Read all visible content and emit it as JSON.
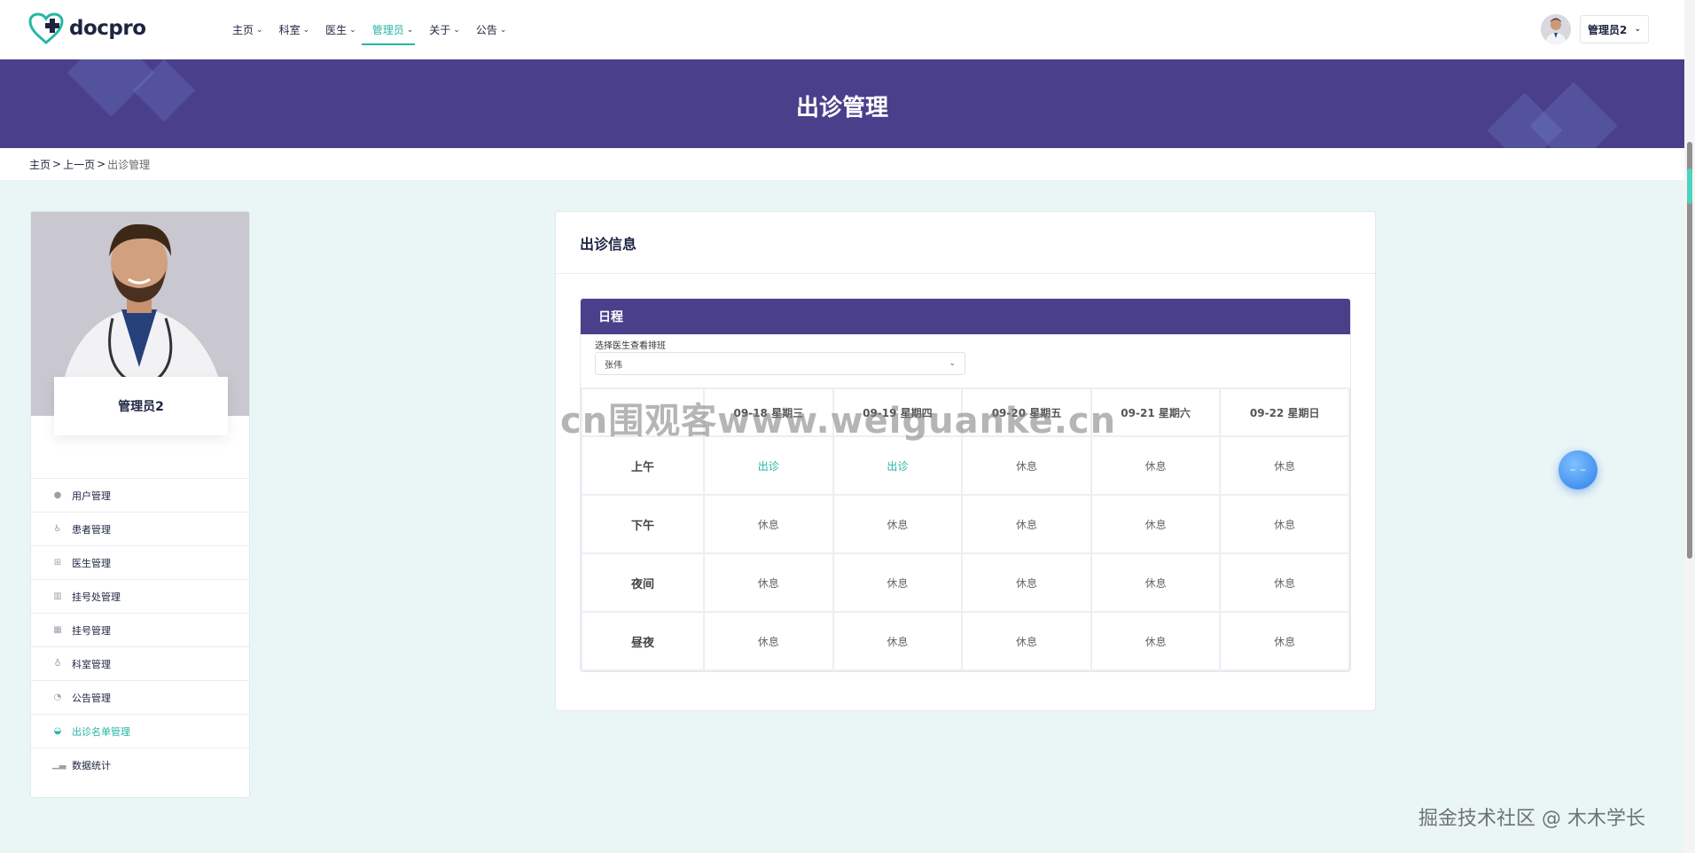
{
  "brand": {
    "name": "docpro",
    "accent": "#26b5a5",
    "banner_color": "#4a3f8b"
  },
  "nav": [
    {
      "label": "主页",
      "active": false
    },
    {
      "label": "科室",
      "active": false
    },
    {
      "label": "医生",
      "active": false
    },
    {
      "label": "管理员",
      "active": true
    },
    {
      "label": "关于",
      "active": false
    },
    {
      "label": "公告",
      "active": false
    }
  ],
  "user": {
    "name": "管理员2"
  },
  "banner": {
    "title": "出诊管理"
  },
  "breadcrumb": {
    "home": "主页",
    "back": "上一页",
    "current": "出诊管理",
    "sep": ">"
  },
  "profile": {
    "name": "管理员2"
  },
  "sidebar": {
    "items": [
      {
        "label": "用户管理",
        "icon": "user-icon",
        "active": false
      },
      {
        "label": "患者管理",
        "icon": "wheelchair-icon",
        "active": false
      },
      {
        "label": "医生管理",
        "icon": "medical-plus-icon",
        "active": false
      },
      {
        "label": "挂号处管理",
        "icon": "building-icon",
        "active": false
      },
      {
        "label": "挂号管理",
        "icon": "calendar-icon",
        "active": false
      },
      {
        "label": "科室管理",
        "icon": "stethoscope-icon",
        "active": false
      },
      {
        "label": "公告管理",
        "icon": "megaphone-icon",
        "active": false
      },
      {
        "label": "出诊名单管理",
        "icon": "pills-icon",
        "active": true
      },
      {
        "label": "数据统计",
        "icon": "chart-icon",
        "active": false
      }
    ]
  },
  "main": {
    "title": "出诊信息",
    "schedule_title": "日程",
    "doctor_select_label": "选择医生查看排班",
    "doctor_selected": "张伟"
  },
  "schedule": {
    "columns": [
      "",
      "09-18 星期三",
      "09-19 星期四",
      "09-20 星期五",
      "09-21 星期六",
      "09-22 星期日"
    ],
    "rows": [
      {
        "label": "上午",
        "cells": [
          "出诊",
          "出诊",
          "休息",
          "休息",
          "休息"
        ]
      },
      {
        "label": "下午",
        "cells": [
          "休息",
          "休息",
          "休息",
          "休息",
          "休息"
        ]
      },
      {
        "label": "夜间",
        "cells": [
          "休息",
          "休息",
          "休息",
          "休息",
          "休息"
        ]
      },
      {
        "label": "昼夜",
        "cells": [
          "休息",
          "休息",
          "休息",
          "休息",
          "休息"
        ]
      }
    ],
    "on_label": "出诊"
  },
  "watermarks": {
    "center": "cn围观客www.weiguanke.cn",
    "corner": "掘金技术社区 @ 木木学长"
  }
}
